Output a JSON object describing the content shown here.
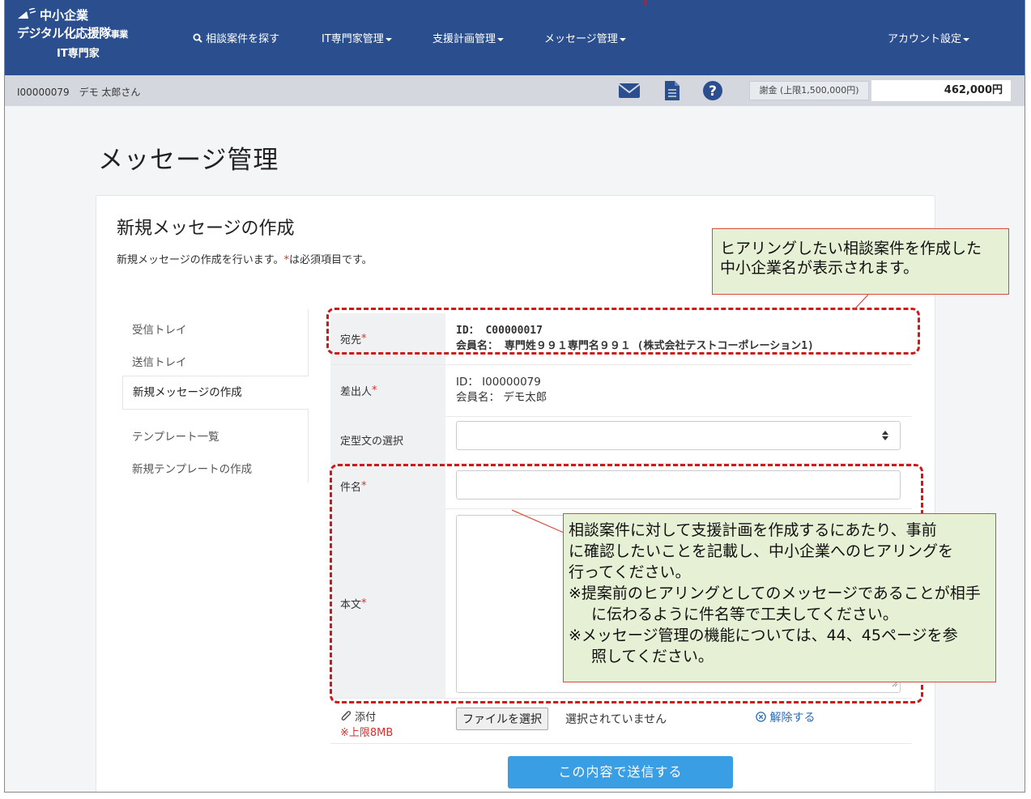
{
  "header": {
    "logo_line1": "中小企業",
    "logo_line2": "デジタル化応援隊",
    "logo_line2_small": "事業",
    "logo_line3": "IT専門家",
    "nav": [
      {
        "label": "相談案件を探す"
      },
      {
        "label": "IT専門家管理"
      },
      {
        "label": "支援計画管理"
      },
      {
        "label": "メッセージ管理"
      }
    ],
    "account_label": "アカウント設定"
  },
  "subbar": {
    "user": "I00000079　デモ 太郎さん",
    "fee_label": "謝金 (上限1,500,000円)",
    "fee_value": "462,000円"
  },
  "page_title": "メッセージ管理",
  "card": {
    "title": "新規メッセージの作成",
    "desc_before": "新規メッセージの作成を行います。",
    "desc_star": "*",
    "desc_after": "は必須項目です。"
  },
  "side_menu": {
    "inbox": "受信トレイ",
    "sent": "送信トレイ",
    "new_message": "新規メッセージの作成",
    "templates": "テンプレート一覧",
    "new_template": "新規テンプレートの作成"
  },
  "form": {
    "to_label": "宛先",
    "to_id": "ID： C00000017",
    "to_name": "会員名： 専門姓９９１専門名９９１ (株式会社テストコーポレーション1)",
    "from_label": "差出人",
    "from_id": "ID： I00000079",
    "from_name": "会員名： デモ太郎",
    "template_label": "定型文の選択",
    "template_value": "",
    "subject_label": "件名",
    "subject_value": "",
    "body_label": "本文",
    "body_value": "",
    "attach_label": "添付",
    "attach_limit": "※上限8MB",
    "file_button": "ファイルを選択",
    "file_status": "選択されていません",
    "clear_label": "解除する",
    "required_mark": "*"
  },
  "send_button": "この内容で送信する",
  "callouts": {
    "top_line1": "ヒアリングしたい相談案件を作成した",
    "top_line2": "中小企業名が表示されます。",
    "body_line1": "相談案件に対して支援計画を作成するにあたり、事前",
    "body_line2": "に確認したいことを記載し、中小企業へのヒアリングを",
    "body_line3": "行ってください。",
    "body_line4": "※提案前のヒアリングとしてのメッセージであることが相手",
    "body_line5": "に伝わるように件名等で工夫してください。",
    "body_line6": "※メッセージ管理の機能については、44、45ページを参",
    "body_line7": "照してください。"
  },
  "colors": {
    "header_bg": "#2b4f8e",
    "subbar_bg": "#d4d8de",
    "send_button": "#3a9ee4",
    "required": "#d9302c",
    "annotation_red": "#d01818",
    "callout_bg": "#e6f0d4"
  }
}
